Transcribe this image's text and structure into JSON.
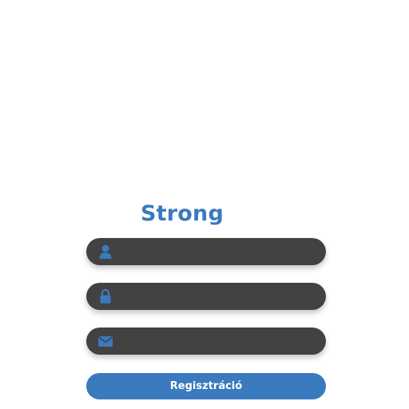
{
  "form": {
    "title": "Strong",
    "username": {
      "value": "",
      "placeholder": "",
      "icon": "user-icon"
    },
    "password": {
      "value": "",
      "placeholder": "",
      "icon": "lock-icon"
    },
    "email": {
      "value": "",
      "placeholder": "",
      "icon": "envelope-icon"
    },
    "submit_label": "Regisztráció"
  },
  "colors": {
    "accent": "#3a7abf",
    "field_background": "#424242",
    "page_background": "#ffffff"
  }
}
